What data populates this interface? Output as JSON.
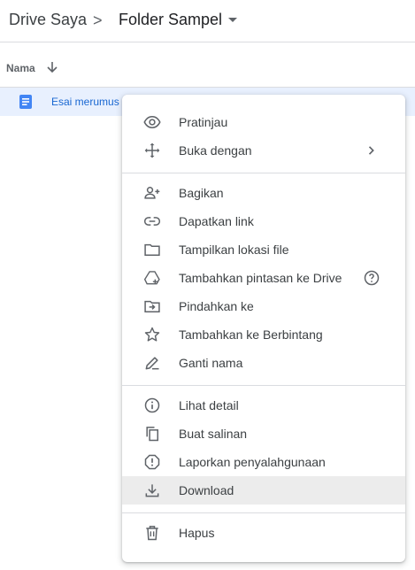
{
  "breadcrumb": {
    "root": "Drive Saya",
    "separator": ">",
    "current": "Folder Sampel"
  },
  "list": {
    "column_name": "Nama"
  },
  "file": {
    "name": "Esai merumus",
    "icon": "docs-icon"
  },
  "menu": {
    "preview": "Pratinjau",
    "open_with": "Buka dengan",
    "share": "Bagikan",
    "get_link": "Dapatkan link",
    "show_location": "Tampilkan lokasi file",
    "add_shortcut": "Tambahkan pintasan ke Drive",
    "move": "Pindahkan ke",
    "star": "Tambahkan ke Berbintang",
    "rename": "Ganti nama",
    "details": "Lihat detail",
    "copy": "Buat salinan",
    "report": "Laporkan penyalahgunaan",
    "download": "Download",
    "delete": "Hapus"
  },
  "colors": {
    "accent": "#1a73e8",
    "selected_row": "#e8f0fe",
    "hover": "#ececec",
    "text": "#3c4043"
  }
}
